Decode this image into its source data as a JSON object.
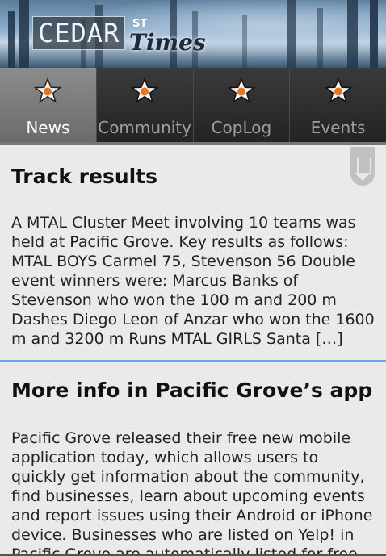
{
  "header": {
    "logo_main": "CEDAR",
    "logo_superscript": "ST",
    "logo_script": "Times"
  },
  "tabs": [
    {
      "label": "News",
      "icon": "star-icon",
      "active": true
    },
    {
      "label": "Community",
      "icon": "star-icon",
      "active": false
    },
    {
      "label": "CopLog",
      "icon": "star-icon",
      "active": false
    },
    {
      "label": "Events",
      "icon": "star-icon",
      "active": false
    }
  ],
  "colors": {
    "accent_divider": "#6aa7e6",
    "star_center": "#e8741d"
  },
  "articles": [
    {
      "title": "Track results",
      "body": "A MTAL Cluster Meet involving 10 teams was held at Pacific Grove. Key results as follows: MTAL BOYS Carmel 75, Stevenson 56 Double event winners were: Marcus Banks of Stevenson who won the 100 m and 200 m Dashes Diego Leon of Anzar who won the 1600 m and 3200 m Runs MTAL GIRLS Santa […]"
    },
    {
      "title": "More info in Pacific Grove’s app",
      "body": "Pacific Grove released their free new mobile application today, which allows users to quickly get information about the community, find businesses, learn about upcoming events and report issues using their Android or iPhone device. Businesses who are listed on Yelp! in Pacific Grove are automatically listed for free in the"
    }
  ]
}
